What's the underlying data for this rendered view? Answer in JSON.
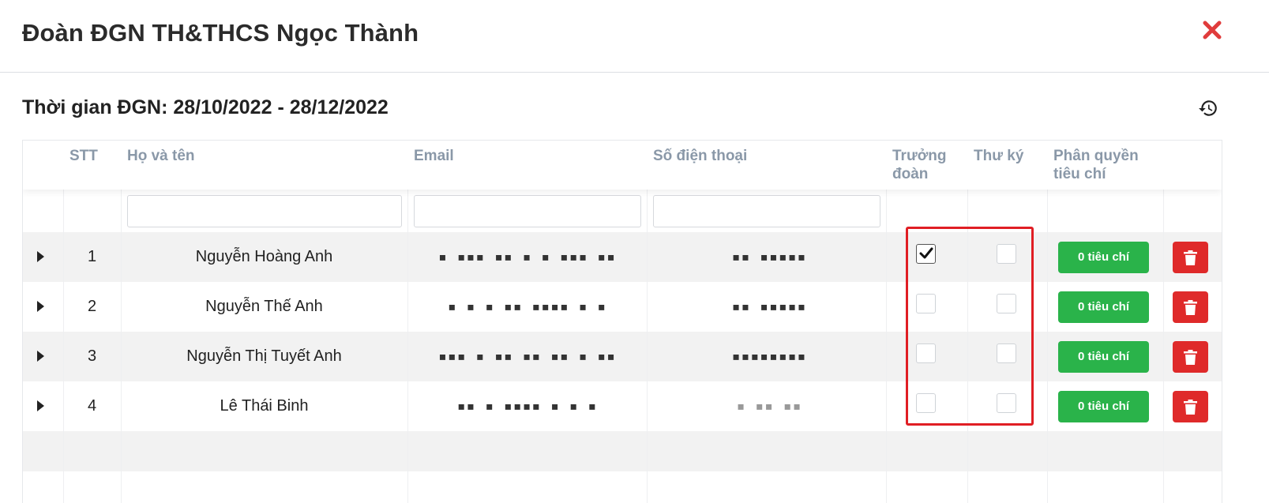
{
  "modal": {
    "title": "Đoàn ĐGN TH&THCS Ngọc Thành",
    "close_icon": "close-icon",
    "period": "Thời gian ĐGN: 28/10/2022 - 28/12/2022",
    "history_icon": "history-icon"
  },
  "table": {
    "headers": {
      "stt": "STT",
      "name": "Họ và tên",
      "email": "Email",
      "phone": "Số điện thoại",
      "leader_line1": "Trưởng",
      "leader_line2": "đoàn",
      "secretary": "Thư ký",
      "perm_line1": "Phân quyền",
      "perm_line2": "tiêu chí"
    },
    "filters": {
      "name": "",
      "email": "",
      "phone": ""
    },
    "rows": [
      {
        "stt": "1",
        "name": "Nguyễn Hoàng Anh",
        "email": "▪ ▪▪▪ ▪▪ ▪ ▪ ▪▪▪ ▪▪",
        "phone": "▪▪ ▪▪▪▪▪",
        "leader": true,
        "secretary": false,
        "criteria": "0 tiêu chí"
      },
      {
        "stt": "2",
        "name": "Nguyễn Thế Anh",
        "email": "▪ ▪ ▪ ▪▪ ▪▪▪▪ ▪ ▪",
        "phone": "▪▪ ▪▪▪▪▪",
        "leader": false,
        "secretary": false,
        "criteria": "0 tiêu chí"
      },
      {
        "stt": "3",
        "name": "Nguyễn Thị Tuyết Anh",
        "email": "▪▪▪ ▪ ▪▪ ▪▪ ▪▪ ▪ ▪▪",
        "phone": "▪▪▪▪▪▪▪▪",
        "leader": false,
        "secretary": false,
        "criteria": "0 tiêu chí"
      },
      {
        "stt": "4",
        "name": "Lê Thái Binh",
        "email": "▪▪ ▪ ▪▪▪▪ ▪ ▪ ▪",
        "phone": "▪ ▪▪ ▪▪",
        "leader": false,
        "secretary": false,
        "criteria": "0 tiêu chí"
      }
    ]
  },
  "colors": {
    "accent_green": "#2ab34a",
    "danger_red": "#df2a2a",
    "highlight_red": "#e01e24",
    "header_text": "#8a98a8"
  }
}
